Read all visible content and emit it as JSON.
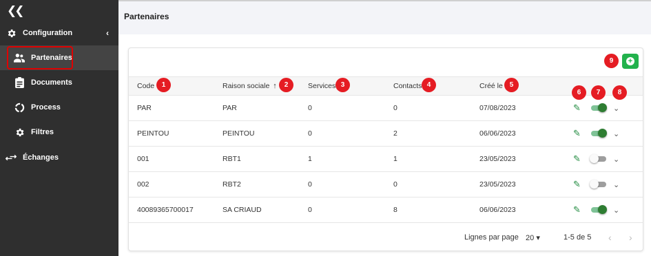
{
  "sidebar": {
    "collapse_icon": "double-chevron-left-icon",
    "items": [
      {
        "label": "Configuration",
        "icon": "gear-icon"
      },
      {
        "label": "Partenaires",
        "icon": "people-icon"
      },
      {
        "label": "Documents",
        "icon": "clipboard-icon"
      },
      {
        "label": "Process",
        "icon": "circle-dashed-icon"
      },
      {
        "label": "Filtres",
        "icon": "gear-icon"
      },
      {
        "label": "Échanges",
        "icon": "swap-arrows-icon"
      }
    ]
  },
  "header": {
    "title": "Partenaires"
  },
  "table": {
    "columns": [
      "Code",
      "Raison sociale",
      "Services",
      "Contacts",
      "Créé le"
    ],
    "rows": [
      {
        "code": "PAR",
        "raison": "PAR",
        "services": "0",
        "contacts": "0",
        "cree": "07/08/2023",
        "active": true
      },
      {
        "code": "PEINTOU",
        "raison": "PEINTOU",
        "services": "0",
        "contacts": "2",
        "cree": "06/06/2023",
        "active": true
      },
      {
        "code": "001",
        "raison": "RBT1",
        "services": "1",
        "contacts": "1",
        "cree": "23/05/2023",
        "active": false
      },
      {
        "code": "002",
        "raison": "RBT2",
        "services": "0",
        "contacts": "0",
        "cree": "23/05/2023",
        "active": false
      },
      {
        "code": "40089365700017",
        "raison": "SA CRIAUD",
        "services": "0",
        "contacts": "8",
        "cree": "06/06/2023",
        "active": true
      }
    ]
  },
  "pagination": {
    "rows_per_page_label": "Lignes par page",
    "rows_per_page": "20",
    "range": "1-5 de 5"
  },
  "badges": [
    "1",
    "2",
    "3",
    "4",
    "5",
    "6",
    "7",
    "8",
    "9"
  ],
  "colors": {
    "sidebar": "#2f2f2f",
    "accent_green": "#22b24c",
    "badge_red": "#e51c23"
  }
}
